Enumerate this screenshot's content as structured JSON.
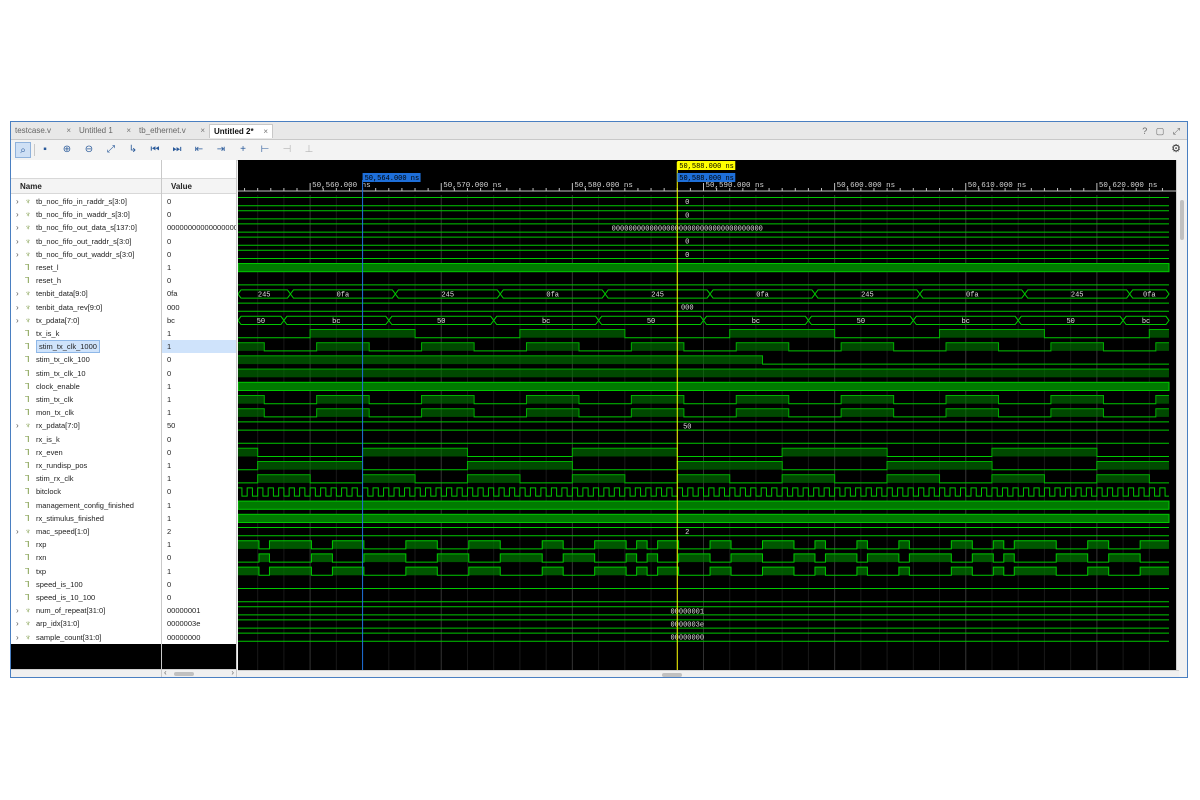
{
  "tabs": [
    {
      "label": "testcase.v",
      "close": "×",
      "active": false
    },
    {
      "label": "Untitled 1",
      "close": "×",
      "active": false
    },
    {
      "label": "tb_ethernet.v",
      "close": "×",
      "active": false
    },
    {
      "label": "Untitled 2*",
      "close": "×",
      "active": true
    }
  ],
  "window_controls": "? ▢ ⤢",
  "toolbar": {
    "icons": [
      "zoom-search-icon",
      "save-icon",
      "zoom-in-icon",
      "zoom-out-icon",
      "zoom-fit-icon",
      "goto-cursor-icon",
      "goto-first-icon",
      "goto-last-icon",
      "prev-transition-icon",
      "next-transition-icon",
      "add-marker-icon",
      "prev-marker-icon",
      "next-marker-icon",
      "swap-cursors-icon"
    ],
    "settings_icon": "gear-icon"
  },
  "columns": {
    "name": "Name",
    "value": "Value"
  },
  "signals": [
    {
      "name": "tb_noc_fifo_in_raddr_s[3:0]",
      "value": "0",
      "bus": true
    },
    {
      "name": "tb_noc_fifo_in_waddr_s[3:0]",
      "value": "0",
      "bus": true
    },
    {
      "name": "tb_noc_fifo_out_data_s[137:0]",
      "value": "000000000000000000",
      "bus": true
    },
    {
      "name": "tb_noc_fifo_out_raddr_s[3:0]",
      "value": "0",
      "bus": true
    },
    {
      "name": "tb_noc_fifo_out_waddr_s[3:0]",
      "value": "0",
      "bus": true
    },
    {
      "name": "reset_l",
      "value": "1",
      "bus": false
    },
    {
      "name": "reset_h",
      "value": "0",
      "bus": false
    },
    {
      "name": "tenbit_data[9:0]",
      "value": "0fa",
      "bus": true
    },
    {
      "name": "tenbit_data_rev[9:0]",
      "value": "000",
      "bus": true
    },
    {
      "name": "tx_pdata[7:0]",
      "value": "bc",
      "bus": true
    },
    {
      "name": "tx_is_k",
      "value": "1",
      "bus": false
    },
    {
      "name": "stim_tx_clk_1000",
      "value": "1",
      "bus": false,
      "selected": true
    },
    {
      "name": "stim_tx_clk_100",
      "value": "0",
      "bus": false
    },
    {
      "name": "stim_tx_clk_10",
      "value": "0",
      "bus": false
    },
    {
      "name": "clock_enable",
      "value": "1",
      "bus": false
    },
    {
      "name": "stim_tx_clk",
      "value": "1",
      "bus": false
    },
    {
      "name": "mon_tx_clk",
      "value": "1",
      "bus": false
    },
    {
      "name": "rx_pdata[7:0]",
      "value": "50",
      "bus": true
    },
    {
      "name": "rx_is_k",
      "value": "0",
      "bus": false
    },
    {
      "name": "rx_even",
      "value": "0",
      "bus": false
    },
    {
      "name": "rx_rundisp_pos",
      "value": "1",
      "bus": false
    },
    {
      "name": "stim_rx_clk",
      "value": "1",
      "bus": false
    },
    {
      "name": "bitclock",
      "value": "0",
      "bus": false
    },
    {
      "name": "management_config_finished",
      "value": "1",
      "bus": false
    },
    {
      "name": "rx_stimulus_finished",
      "value": "1",
      "bus": false
    },
    {
      "name": "mac_speed[1:0]",
      "value": "2",
      "bus": true
    },
    {
      "name": "rxp",
      "value": "1",
      "bus": false
    },
    {
      "name": "rxn",
      "value": "0",
      "bus": false
    },
    {
      "name": "txp",
      "value": "1",
      "bus": false
    },
    {
      "name": "speed_is_100",
      "value": "0",
      "bus": false
    },
    {
      "name": "speed_is_10_100",
      "value": "0",
      "bus": false
    },
    {
      "name": "num_of_repeat[31:0]",
      "value": "00000001",
      "bus": true
    },
    {
      "name": "arp_idx[31:0]",
      "value": "0000003e",
      "bus": true
    },
    {
      "name": "sample_count[31:0]",
      "value": "00000000",
      "bus": true
    }
  ],
  "timeline": {
    "range_ns": [
      50554.5,
      50625.5
    ],
    "major_ticks_ns": [
      50560,
      50570,
      50580,
      50590,
      50600,
      50610,
      50620
    ],
    "major_tick_labels": [
      "50,560.000 ns",
      "50,570.000 ns",
      "50,580.000 ns",
      "50,590.000 ns",
      "50,600.000 ns",
      "50,610.000 ns",
      "50,620.000 ns"
    ],
    "cursor_primary": {
      "time_ns": 50588,
      "label": "50,588.000 ns",
      "color": "#ffff00"
    },
    "cursor_secondary": {
      "time_ns": 50588,
      "label": "50,588.000 ns",
      "color": "#1e6fd9"
    },
    "marker": {
      "time_ns": 50564,
      "label": "50,564.000 ns",
      "color": "#1e6fd9"
    }
  },
  "waves": {
    "bus_constant_labels": {
      "tb_noc_fifo_in_raddr_s[3:0]": "0",
      "tb_noc_fifo_in_waddr_s[3:0]": "0",
      "tb_noc_fifo_out_data_s[137:0]": "000000000000000000000000000000000000",
      "tb_noc_fifo_out_raddr_s[3:0]": "0",
      "tb_noc_fifo_out_waddr_s[3:0]": "0",
      "tenbit_data_rev[9:0]": "000",
      "rx_pdata[7:0]": "50",
      "mac_speed[1:0]": "2",
      "num_of_repeat[31:0]": "00000001",
      "arp_idx[31:0]": "0000003e",
      "sample_count[31:0]": "00000000"
    },
    "tenbit_data_segments": [
      {
        "start": 50554.5,
        "end": 50558.5,
        "label": "245"
      },
      {
        "start": 50558.5,
        "end": 50566.5,
        "label": "0fa"
      },
      {
        "start": 50566.5,
        "end": 50574.5,
        "label": "245"
      },
      {
        "start": 50574.5,
        "end": 50582.5,
        "label": "0fa"
      },
      {
        "start": 50582.5,
        "end": 50590.5,
        "label": "245"
      },
      {
        "start": 50590.5,
        "end": 50598.5,
        "label": "0fa"
      },
      {
        "start": 50598.5,
        "end": 50606.5,
        "label": "245"
      },
      {
        "start": 50606.5,
        "end": 50614.5,
        "label": "0fa"
      },
      {
        "start": 50614.5,
        "end": 50622.5,
        "label": "245"
      },
      {
        "start": 50622.5,
        "end": 50625.5,
        "label": "0fa"
      }
    ],
    "tx_pdata_segments": [
      {
        "start": 50554.5,
        "end": 50558,
        "label": "50"
      },
      {
        "start": 50558,
        "end": 50566,
        "label": "bc"
      },
      {
        "start": 50566,
        "end": 50574,
        "label": "50"
      },
      {
        "start": 50574,
        "end": 50582,
        "label": "bc"
      },
      {
        "start": 50582,
        "end": 50590,
        "label": "50"
      },
      {
        "start": 50590,
        "end": 50598,
        "label": "bc"
      },
      {
        "start": 50598,
        "end": 50606,
        "label": "50"
      },
      {
        "start": 50606,
        "end": 50614,
        "label": "bc"
      },
      {
        "start": 50614,
        "end": 50622,
        "label": "50"
      },
      {
        "start": 50622,
        "end": 50625.5,
        "label": "bc"
      }
    ]
  },
  "colors": {
    "wave": "#00c800",
    "bus_fill": "#007a00",
    "grid": "#1a1a1a",
    "background": "#000000",
    "frame_border": "#4a7fc1"
  }
}
